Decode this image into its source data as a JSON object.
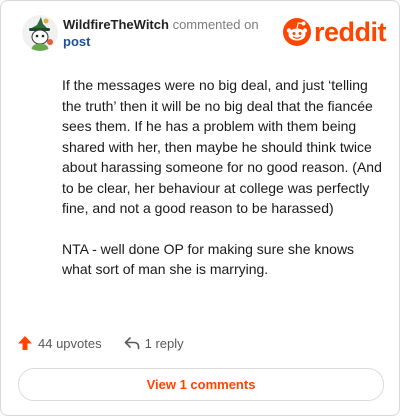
{
  "comment": {
    "author": "WildfireTheWitch",
    "action_text": "commented on",
    "post_link": "post",
    "paragraphs": [
      "If the messages were no big deal, and just ‘telling the truth’ then it will be no big deal that the fiancée sees them. If he has a problem with them being shared with her, then maybe he should think twice about harassing someone for no good reason. (And to be clear, her behaviour at college was perfectly fine, and not a good reason to be harassed)",
      "NTA - well done OP for making sure she knows what sort of man she is marrying."
    ]
  },
  "brand": {
    "logo_text": "reddit",
    "logo_icon": "reddit-snoo-icon",
    "color": "#ff4500"
  },
  "footer": {
    "upvotes_label": "44 upvotes",
    "upvote_icon": "upvote-arrow-icon",
    "replies_label": "1 reply",
    "reply_icon": "reply-icon"
  },
  "view_comments_label": "View 1 comments"
}
